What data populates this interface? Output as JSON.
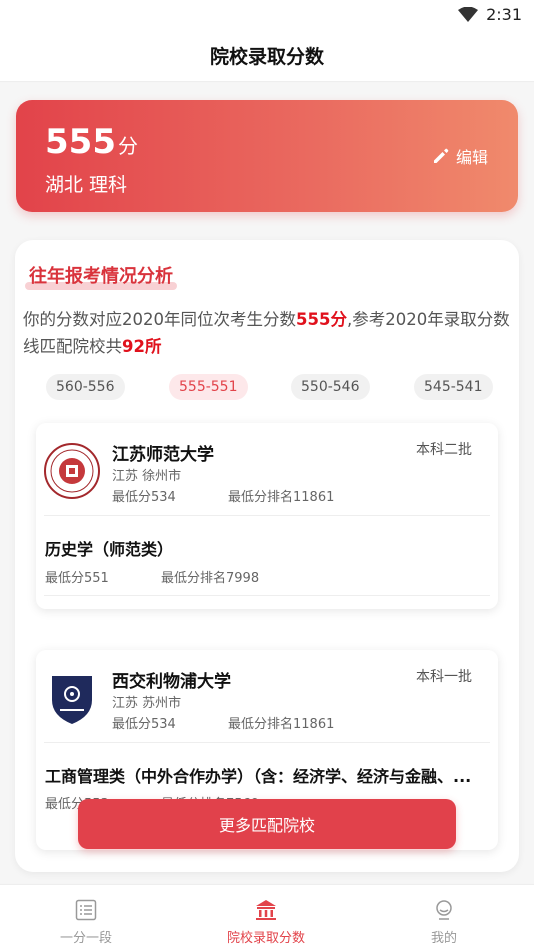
{
  "status": {
    "time": "2:31"
  },
  "header": {
    "title": "院校录取分数"
  },
  "score_card": {
    "score": "555",
    "unit": "分",
    "region": "湖北 理科",
    "edit_label": "编辑"
  },
  "analysis": {
    "title": "往年报考情况分析",
    "desc_1": "你的分数对应2020年同位次考生分数",
    "desc_score": "555分",
    "desc_2": ",参考2020年录取分数线匹配院校共",
    "desc_count": "92所"
  },
  "ranges": [
    "560-556",
    "555-551",
    "550-546",
    "545-541"
  ],
  "active_range": "555-551",
  "universities": [
    {
      "name": "江苏师范大学",
      "batch": "本科二批",
      "location": "江苏 徐州市",
      "min_score": "最低分534",
      "min_rank": "最低分排名11861",
      "major": {
        "name": "历史学（师范类）",
        "min_score": "最低分551",
        "min_rank": "最低分排名7998"
      }
    },
    {
      "name": "西交利物浦大学",
      "batch": "本科一批",
      "location": "江苏 苏州市",
      "min_score": "最低分534",
      "min_rank": "最低分排名11861",
      "major": {
        "name": "工商管理类（中外合作办学）（含：经济学、经济与金融、...",
        "min_score": "最低分553",
        "min_rank": "最低分排名7569"
      }
    }
  ],
  "more_button": "更多匹配院校",
  "tabs": [
    {
      "label": "一分一段",
      "icon": "list-icon"
    },
    {
      "label": "院校录取分数",
      "icon": "school-icon"
    },
    {
      "label": "我的",
      "icon": "profile-icon"
    }
  ],
  "colors": {
    "accent": "#e2434a",
    "highlight": "#e0111c"
  }
}
